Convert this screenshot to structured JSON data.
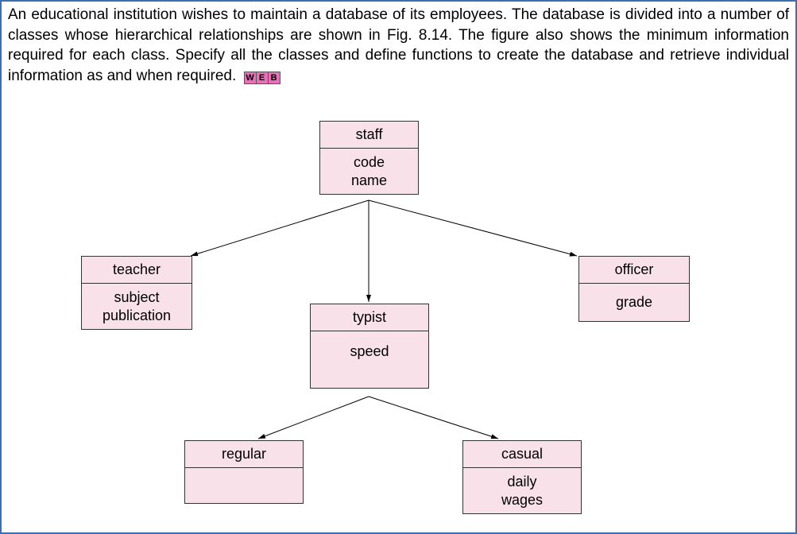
{
  "problem": {
    "text": "An educational institution wishes to maintain a database of its employees. The database is divided into a number of classes whose hierarchical relationships are shown in Fig. 8.14. The figure also shows the minimum information required for each class. Specify all the classes and define functions to create the database and retrieve individual information as and when required.",
    "badge": {
      "w": "W",
      "e": "E",
      "b": "B"
    }
  },
  "diagram": {
    "nodes": {
      "staff": {
        "title": "staff",
        "attrs": "code\nname"
      },
      "teacher": {
        "title": "teacher",
        "attrs": "subject\npublication"
      },
      "typist": {
        "title": "typist",
        "attrs": "speed"
      },
      "officer": {
        "title": "officer",
        "attrs": "grade"
      },
      "regular": {
        "title": "regular",
        "attrs": ""
      },
      "casual": {
        "title": "casual",
        "attrs": "daily\nwages"
      }
    },
    "edges": [
      {
        "from": "staff",
        "to": "teacher"
      },
      {
        "from": "staff",
        "to": "typist"
      },
      {
        "from": "staff",
        "to": "officer"
      },
      {
        "from": "typist",
        "to": "regular"
      },
      {
        "from": "typist",
        "to": "casual"
      }
    ]
  }
}
